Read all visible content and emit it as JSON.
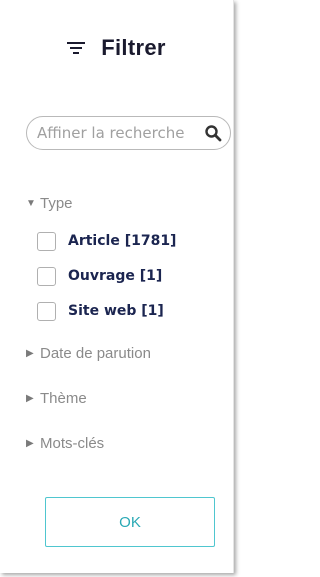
{
  "header": {
    "title": "Filtrer",
    "icon": "filter-lines-icon"
  },
  "search": {
    "placeholder": "Affiner la recherche",
    "value": "",
    "icon": "search-icon"
  },
  "sections": {
    "type": {
      "label": "Type",
      "expanded": true,
      "options": [
        {
          "label": "Article [1781]",
          "checked": false
        },
        {
          "label": "Ouvrage [1]",
          "checked": false
        },
        {
          "label": "Site web [1]",
          "checked": false
        }
      ]
    },
    "date": {
      "label": "Date de parution",
      "expanded": false
    },
    "theme": {
      "label": "Thème",
      "expanded": false
    },
    "keywords": {
      "label": "Mots-clés",
      "expanded": false
    }
  },
  "actions": {
    "ok_label": "OK"
  },
  "colors": {
    "title": "#1a1a2e",
    "option_text": "#1b2550",
    "section_text": "#8a8a8a",
    "accent": "#2aa9b5",
    "accent_border": "#4fc6cf"
  }
}
